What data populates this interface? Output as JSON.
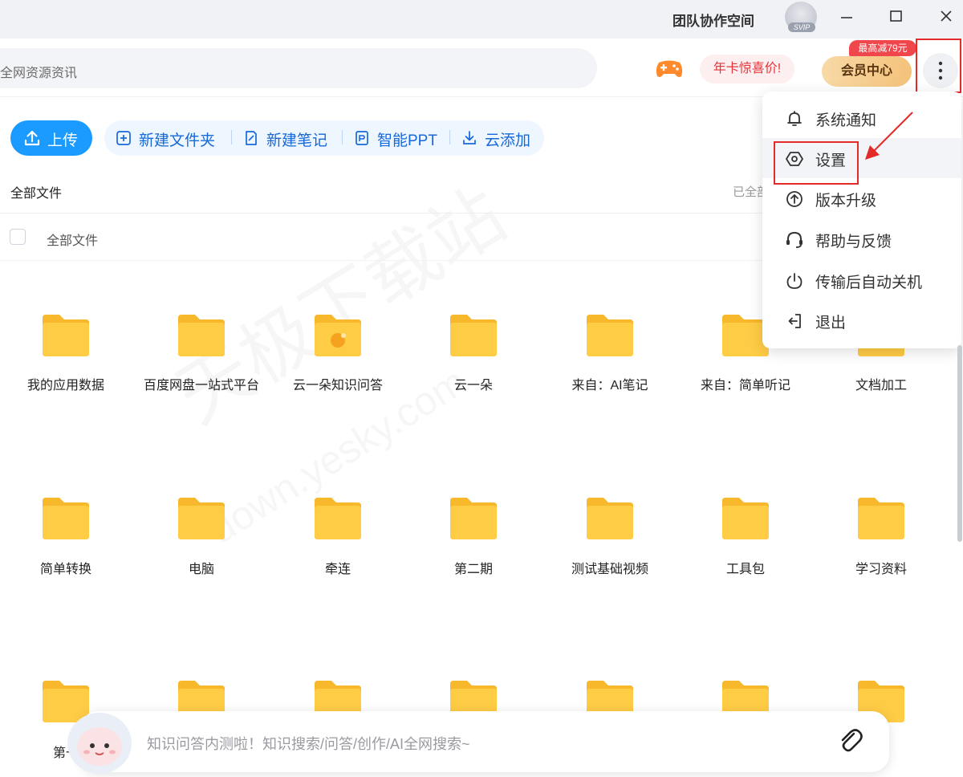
{
  "titlebar": {
    "team_label": "团队协作空间",
    "vip_badge": "SVIP"
  },
  "search": {
    "placeholder": "全网资源资讯"
  },
  "header": {
    "year_card": "年卡惊喜价!",
    "vip_center": "会员中心",
    "promo_badge": "最高减79元"
  },
  "toolbar": {
    "upload": "上传",
    "new_folder": "新建文件夹",
    "new_note": "新建笔记",
    "smart_ppt": "智能PPT",
    "cloud_add": "云添加"
  },
  "breadcrumb": {
    "current": "全部文件",
    "right_text": "已全部"
  },
  "list_header": {
    "all_files": "全部文件"
  },
  "folders_row1": [
    "我的应用数据",
    "百度网盘一站式平台",
    "云一朵知识问答",
    "云一朵",
    "来自：AI笔记",
    "来自：简单听记",
    "文档加工"
  ],
  "folders_row2": [
    "简单转换",
    "电脑",
    "牵连",
    "第二期",
    "测试基础视频",
    "工具包",
    "学习资料"
  ],
  "folders_row3": [
    "第一"
  ],
  "menu": {
    "items": [
      {
        "label": "系统通知",
        "icon": "bell-icon"
      },
      {
        "label": "设置",
        "icon": "settings-hexagon-icon"
      },
      {
        "label": "版本升级",
        "icon": "upgrade-icon"
      },
      {
        "label": "帮助与反馈",
        "icon": "headset-icon"
      },
      {
        "label": "传输后自动关机",
        "icon": "power-icon"
      },
      {
        "label": "退出",
        "icon": "logout-icon"
      }
    ]
  },
  "chat": {
    "placeholder": "知识问答内测啦！知识搜索/问答/创作/AI全网搜索~"
  },
  "watermark": {
    "cn": "天极下载站",
    "url": "down.yesky.com"
  },
  "colors": {
    "accent": "#1b9aff",
    "folder": "#ffc83d",
    "highlight": "#e52a2a"
  }
}
